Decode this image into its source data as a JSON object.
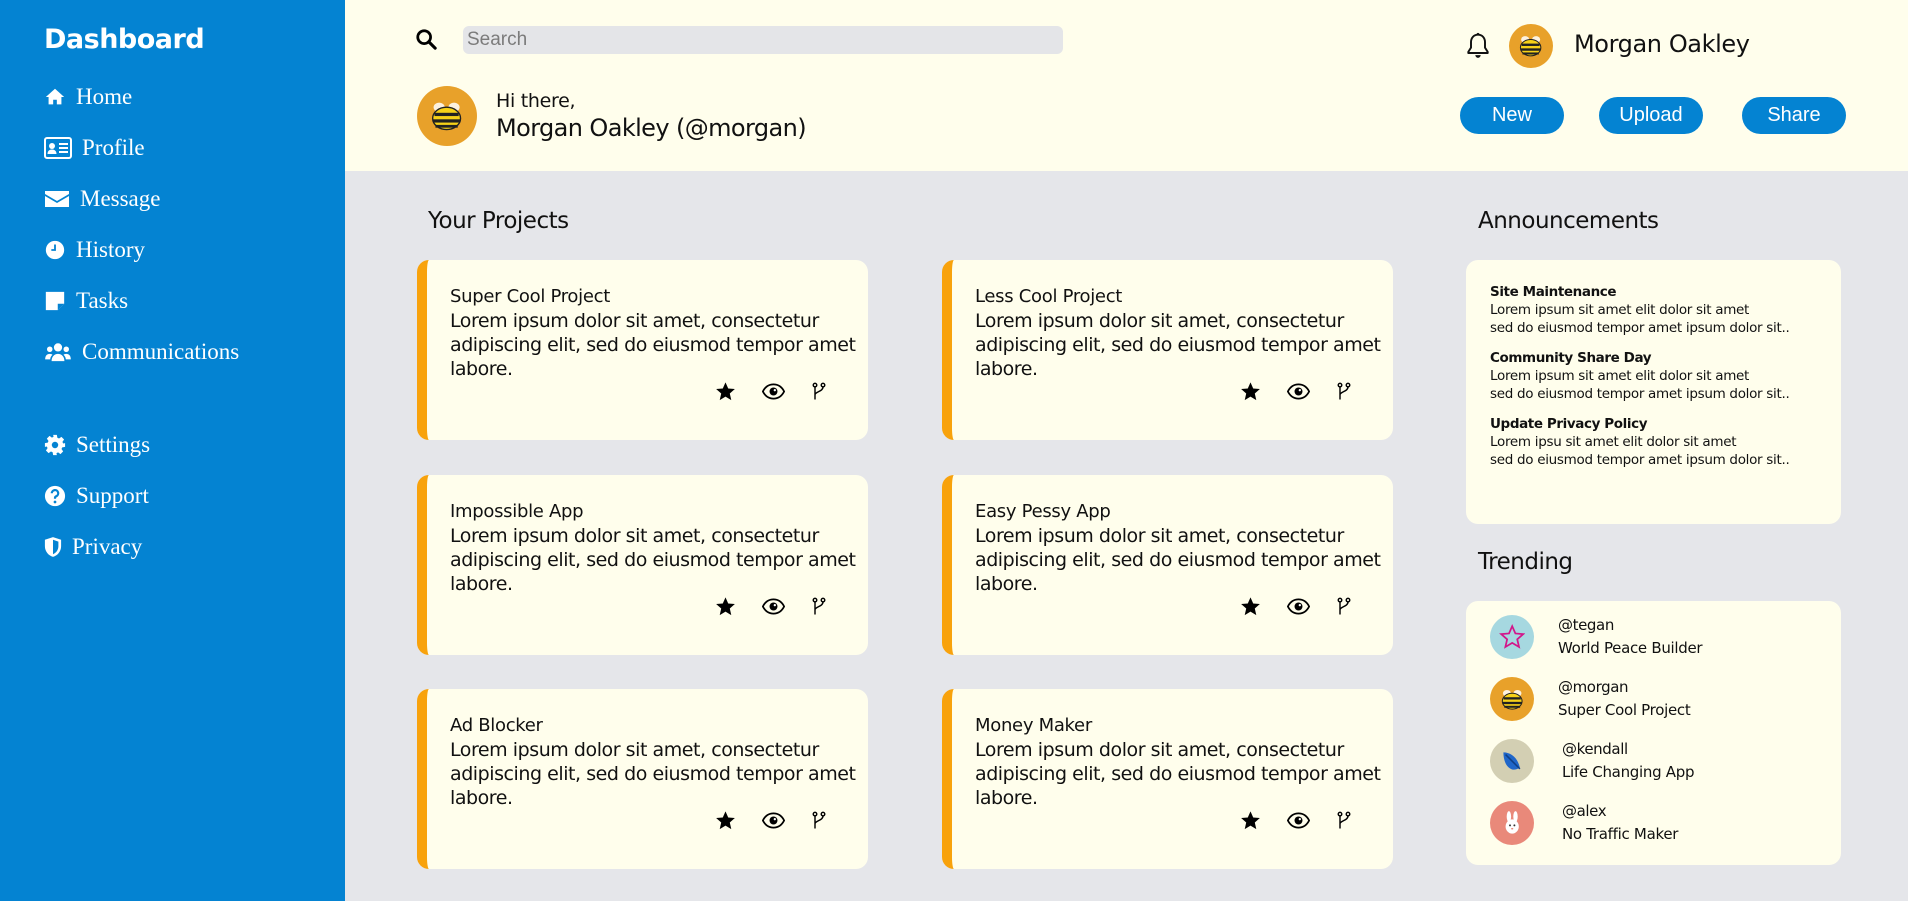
{
  "sidebar": {
    "brand": "Dashboard",
    "items": [
      {
        "label": "Home",
        "icon": "home-icon"
      },
      {
        "label": "Profile",
        "icon": "id-card-icon"
      },
      {
        "label": "Message",
        "icon": "envelope-icon"
      },
      {
        "label": "History",
        "icon": "clock-icon"
      },
      {
        "label": "Tasks",
        "icon": "sticky-note-icon"
      },
      {
        "label": "Communications",
        "icon": "users-icon"
      },
      {
        "label": "Settings",
        "icon": "gear-icon"
      },
      {
        "label": "Support",
        "icon": "question-circle-icon"
      },
      {
        "label": "Privacy",
        "icon": "shield-icon"
      }
    ]
  },
  "header": {
    "search": {
      "placeholder": "Search",
      "value": ""
    },
    "user_name": "Morgan Oakley",
    "greeting": "Hi there,",
    "greeting_name": "Morgan Oakley (@morgan)",
    "buttons": {
      "new": "New",
      "upload": "Upload",
      "share": "Share"
    }
  },
  "projects": {
    "title": "Your Projects",
    "items": [
      {
        "title": "Super Cool Project",
        "description": "Lorem ipsum dolor sit amet, consectetur adipiscing elit, sed do eiusmod tempor amet labore."
      },
      {
        "title": "Less Cool Project",
        "description": "Lorem ipsum dolor sit amet, consectetur adipiscing elit, sed do eiusmod tempor amet labore."
      },
      {
        "title": "Impossible App",
        "description": "Lorem ipsum dolor sit amet, consectetur adipiscing elit, sed do eiusmod tempor amet labore."
      },
      {
        "title": "Easy Pessy App",
        "description": "Lorem ipsum dolor sit amet, consectetur adipiscing elit, sed do eiusmod tempor amet labore."
      },
      {
        "title": "Ad Blocker",
        "description": "Lorem ipsum dolor sit amet, consectetur adipiscing elit, sed do eiusmod tempor amet labore."
      },
      {
        "title": "Money Maker",
        "description": "Lorem ipsum dolor sit amet, consectetur adipiscing elit, sed do eiusmod tempor amet labore."
      }
    ]
  },
  "announcements": {
    "title": "Announcements",
    "items": [
      {
        "title": "Site Maintenance",
        "line1": "Lorem ipsum sit amet elit dolor sit amet",
        "line2": "sed do eiusmod tempor amet ipsum dolor sit.."
      },
      {
        "title": "Community Share Day",
        "line1": "Lorem ipsum sit amet elit dolor sit amet",
        "line2": "sed do eiusmod tempor amet ipsum dolor sit.."
      },
      {
        "title": "Update Privacy Policy",
        "line1": "Lorem ipsu sit amet elit dolor sit amet",
        "line2": "sed do eiusmod tempor amet ipsum dolor sit.."
      }
    ]
  },
  "trending": {
    "title": "Trending",
    "items": [
      {
        "handle": "@tegan",
        "project": "World Peace Builder",
        "avatar_color": "#a6d8e0",
        "icon": "star-icon"
      },
      {
        "handle": "@morgan",
        "project": "Super Cool Project",
        "avatar_color": "#e8a12a",
        "icon": "bee-icon"
      },
      {
        "handle": "@kendall",
        "project": "Life Changing App",
        "avatar_color": "#d3cfb3",
        "icon": "feather-icon"
      },
      {
        "handle": "@alex",
        "project": "No Traffic Maker",
        "avatar_color": "#e9897a",
        "icon": "rabbit-icon"
      }
    ]
  },
  "colors": {
    "accent": "#0483d2",
    "card_border": "#f8a20c",
    "card_bg": "#fffeec",
    "page_bg": "#e5e6ea"
  }
}
